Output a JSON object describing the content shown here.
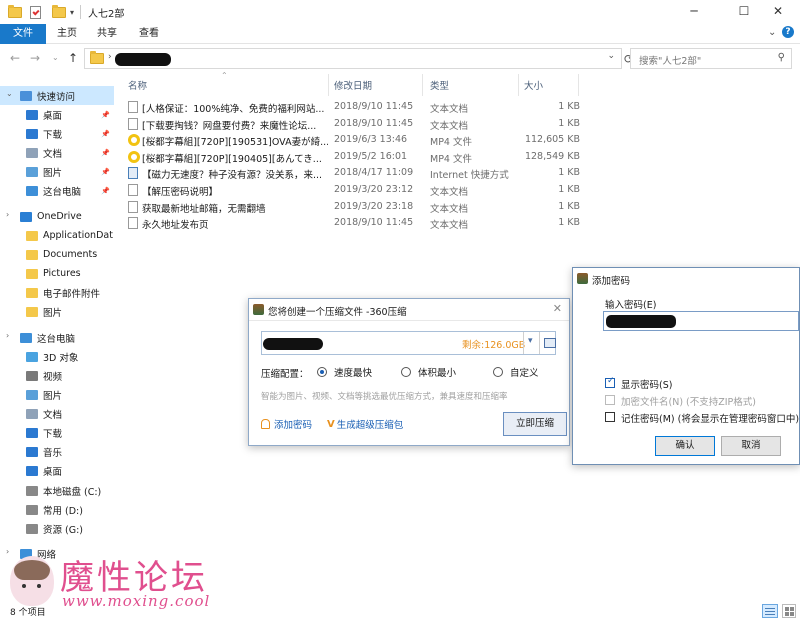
{
  "window": {
    "title": "人七2部"
  },
  "ribbon": {
    "tabs": [
      "文件",
      "主页",
      "共享",
      "查看"
    ]
  },
  "address": {
    "search_placeholder": "搜索\"人七2部\""
  },
  "sidebar": {
    "items": [
      {
        "label": "快速访问",
        "icon": "star-icon",
        "color": "#4a90d9"
      },
      {
        "label": "桌面",
        "icon": "desktop-icon",
        "color": "#2b79d1",
        "pinned": true
      },
      {
        "label": "下载",
        "icon": "download-icon",
        "color": "#2b79d1",
        "pinned": true
      },
      {
        "label": "文档",
        "icon": "document-icon",
        "color": "#8fa2b8",
        "pinned": true
      },
      {
        "label": "图片",
        "icon": "pictures-icon",
        "color": "#5aa0d9",
        "pinned": true
      },
      {
        "label": "这台电脑",
        "icon": "computer-icon",
        "color": "#3d8fd8",
        "pinned": true
      },
      {
        "label": "OneDrive",
        "icon": "cloud-icon",
        "color": "#2a7fd4"
      },
      {
        "label": "ApplicationDat",
        "icon": "folder-icon",
        "color": "#f4c84a"
      },
      {
        "label": "Documents",
        "icon": "folder-icon",
        "color": "#f4c84a"
      },
      {
        "label": "Pictures",
        "icon": "folder-icon",
        "color": "#f4c84a"
      },
      {
        "label": "电子邮件附件",
        "icon": "folder-icon",
        "color": "#f4c84a"
      },
      {
        "label": "图片",
        "icon": "folder-icon",
        "color": "#f4c84a"
      },
      {
        "label": "这台电脑",
        "icon": "computer-icon",
        "color": "#3d8fd8"
      },
      {
        "label": "3D 对象",
        "icon": "3d-objects-icon",
        "color": "#4aa3e0"
      },
      {
        "label": "视频",
        "icon": "video-icon",
        "color": "#7a7a7a"
      },
      {
        "label": "图片",
        "icon": "pictures-icon",
        "color": "#5aa0d9"
      },
      {
        "label": "文档",
        "icon": "document-icon",
        "color": "#8fa2b8"
      },
      {
        "label": "下载",
        "icon": "download-icon",
        "color": "#2b79d1"
      },
      {
        "label": "音乐",
        "icon": "music-icon",
        "color": "#2b79d1"
      },
      {
        "label": "桌面",
        "icon": "desktop-icon",
        "color": "#2b79d1"
      },
      {
        "label": "本地磁盘 (C:)",
        "icon": "disk-icon",
        "color": "#888888"
      },
      {
        "label": "常用 (D:)",
        "icon": "disk-icon",
        "color": "#888888"
      },
      {
        "label": "资源 (G:)",
        "icon": "disk-icon",
        "color": "#888888"
      },
      {
        "label": "网络",
        "icon": "network-icon",
        "color": "#3d8fd8"
      }
    ]
  },
  "columns": {
    "name": "名称",
    "date": "修改日期",
    "type": "类型",
    "size": "大小"
  },
  "files": [
    {
      "name": "[人格保证：100%纯净、免费的福利网站...",
      "date": "2018/9/10 11:45",
      "type": "文本文档",
      "size": "1 KB",
      "kind": "txt"
    },
    {
      "name": "[下载要掏钱？网盘要付费？来魔性论坛...",
      "date": "2018/9/10 11:45",
      "type": "文本文档",
      "size": "1 KB",
      "kind": "txt"
    },
    {
      "name": "[桜都字幕組][720P][190531]OVA妻が綺...",
      "date": "2019/6/3 13:46",
      "type": "MP4 文件",
      "size": "112,605 KB",
      "kind": "mp4"
    },
    {
      "name": "[桜都字幕組][720P][190405][あんてき...",
      "date": "2019/5/2 16:01",
      "type": "MP4 文件",
      "size": "128,549 KB",
      "kind": "mp4"
    },
    {
      "name": "【磁力无速度？种子没有源？没关系，来...",
      "date": "2018/4/17 11:09",
      "type": "Internet 快捷方式",
      "size": "1 KB",
      "kind": "url"
    },
    {
      "name": "【解压密码说明】",
      "date": "2019/3/20 23:12",
      "type": "文本文档",
      "size": "1 KB",
      "kind": "txt"
    },
    {
      "name": "获取最新地址邮箱，无需翻墙",
      "date": "2019/3/20 23:18",
      "type": "文本文档",
      "size": "1 KB",
      "kind": "txt"
    },
    {
      "name": "永久地址发布页",
      "date": "2018/9/10 11:45",
      "type": "文本文档",
      "size": "1 KB",
      "kind": "txt"
    }
  ],
  "status": {
    "count": "8 个项目"
  },
  "compress_dialog": {
    "title": "您将创建一个压缩文件 -360压缩",
    "free_space": "剩余:126.0GB",
    "config_label": "压缩配置：",
    "options": [
      "速度最快",
      "体积最小",
      "自定义"
    ],
    "selected_option": 0,
    "hint": "智能为图片、视频、文档等挑选最优压缩方式，兼具速度和压缩率",
    "add_password": "添加密码",
    "super_compress": "生成超级压缩包",
    "compress_now": "立即压缩",
    "accent": "#e8911f"
  },
  "password_dialog": {
    "title": "添加密码",
    "input_label": "输入密码(E)",
    "show_password": "显示密码(S)",
    "show_password_checked": true,
    "encrypt_names": "加密文件名(N) (不支持ZIP格式)",
    "remember": "记住密码(M) (将会显示在管理密码窗口中)",
    "ok": "确认",
    "cancel": "取消"
  },
  "watermark": {
    "text": "魔性论坛",
    "url": "www.moxing.cool"
  }
}
